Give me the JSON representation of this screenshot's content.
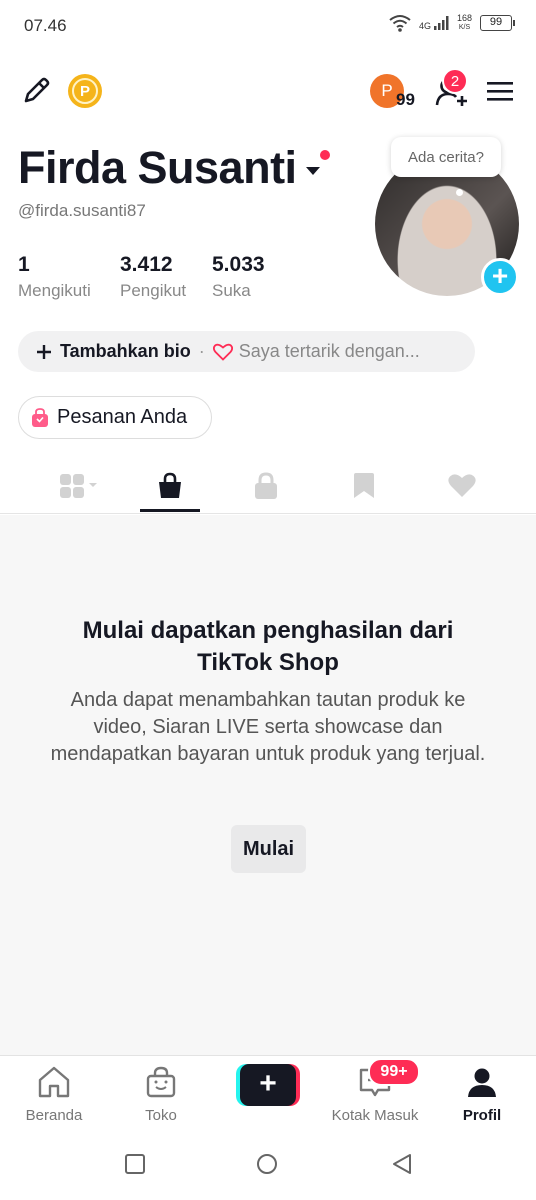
{
  "status_bar": {
    "time": "07.46",
    "network": "4G",
    "speed_value": "168",
    "speed_unit": "K/S",
    "battery": "99"
  },
  "header": {
    "points_count": "99",
    "points_letter": "P",
    "coin_letter": "P",
    "friend_requests": "2"
  },
  "profile": {
    "name": "Firda Susanti",
    "username": "@firda.susanti87",
    "story_prompt": "Ada cerita?",
    "stats": [
      {
        "value": "1",
        "label": "Mengikuti"
      },
      {
        "value": "3.412",
        "label": "Pengikut"
      },
      {
        "value": "5.033",
        "label": "Suka"
      }
    ]
  },
  "bio": {
    "add_label": "Tambahkan bio",
    "separator": "·",
    "interest_label": "Saya tertarik dengan..."
  },
  "orders": {
    "label": "Pesanan Anda"
  },
  "shop": {
    "title": "Mulai dapatkan penghasilan dari TikTok Shop",
    "description": "Anda dapat menambahkan tautan produk ke video, Siaran LIVE serta showcase dan mendapatkan bayaran untuk produk yang terjual.",
    "button": "Mulai"
  },
  "bottom_nav": {
    "home": "Beranda",
    "shop": "Toko",
    "inbox": "Kotak Masuk",
    "inbox_badge": "99+",
    "profile": "Profil"
  },
  "colors": {
    "accent_red": "#fe2c55",
    "accent_cyan": "#25f4ee",
    "avatar_plus": "#20c4f0",
    "coin": "#f5b41a",
    "points_orb": "#f0742a"
  }
}
